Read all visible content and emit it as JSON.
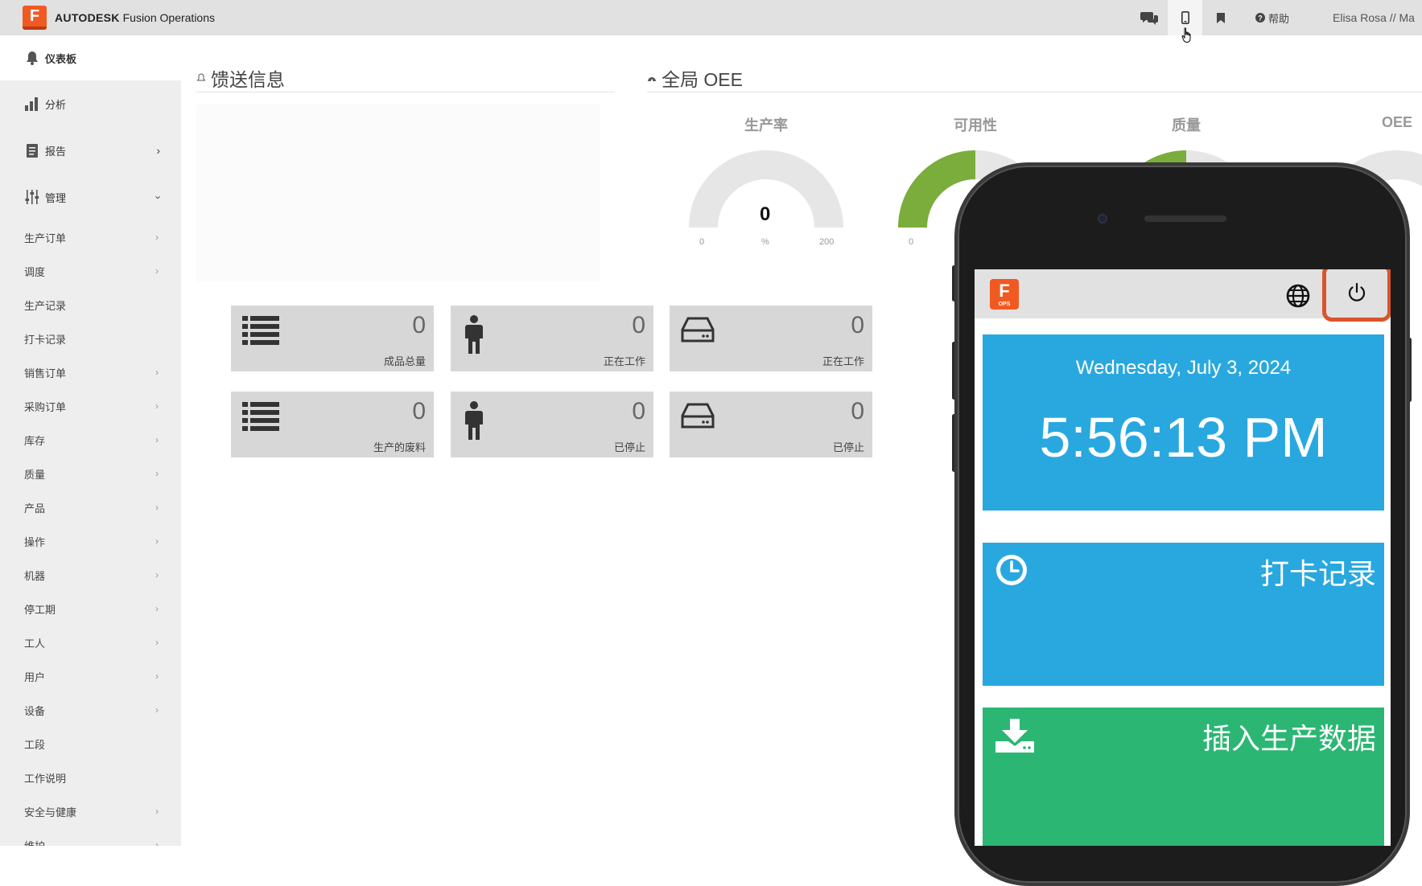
{
  "topbar": {
    "brand_bold": "AUTODESK",
    "brand_rest": " Fusion Operations",
    "help_label": "帮助",
    "user": "Elisa Rosa // Ma"
  },
  "sidebar": {
    "dashboard": "仪表板",
    "analysis": "分析",
    "reports": "报告",
    "manage": "管理",
    "items": [
      {
        "label": "生产订单",
        "chev": true
      },
      {
        "label": "调度",
        "chev": true
      },
      {
        "label": "生产记录",
        "chev": false
      },
      {
        "label": "打卡记录",
        "chev": false
      },
      {
        "label": "销售订单",
        "chev": true
      },
      {
        "label": "采购订单",
        "chev": true
      },
      {
        "label": "库存",
        "chev": true
      },
      {
        "label": "质量",
        "chev": true
      },
      {
        "label": "产品",
        "chev": true
      },
      {
        "label": "操作",
        "chev": true
      },
      {
        "label": "机器",
        "chev": true
      },
      {
        "label": "停工期",
        "chev": true
      },
      {
        "label": "工人",
        "chev": true
      },
      {
        "label": "用户",
        "chev": true
      },
      {
        "label": "设备",
        "chev": true
      },
      {
        "label": "工段",
        "chev": false
      },
      {
        "label": "工作说明",
        "chev": false
      },
      {
        "label": "安全与健康",
        "chev": true
      },
      {
        "label": "维护",
        "chev": true
      }
    ]
  },
  "feed": {
    "title": "馈送信息"
  },
  "oee": {
    "title": "全局 OEE",
    "gauges": [
      {
        "label": "生产率",
        "value": "0",
        "min": "0",
        "unit": "%",
        "max": "200",
        "fill": 0
      },
      {
        "label": "可用性",
        "min": "0",
        "fill": 1
      },
      {
        "label": "质量",
        "fill": 1
      },
      {
        "label": "OEE",
        "fill": 0
      }
    ]
  },
  "tiles": [
    {
      "icon": "list-icon",
      "value": "0",
      "label": "成品总量"
    },
    {
      "icon": "person-icon",
      "value": "0",
      "label": "正在工作"
    },
    {
      "icon": "drive-icon",
      "value": "0",
      "label": "正在工作"
    },
    {
      "icon": "list-icon",
      "value": "0",
      "label": "生产的废料"
    },
    {
      "icon": "person-icon",
      "value": "0",
      "label": "已停止"
    },
    {
      "icon": "drive-icon",
      "value": "0",
      "label": "已停止"
    }
  ],
  "mobile": {
    "logo_letter": "F",
    "logo_sub": "OPS",
    "date": "Wednesday, July 3, 2024",
    "time": "5:56:13 PM",
    "card1": "打卡记录",
    "card2": "插入生产数据"
  },
  "colors": {
    "accent_orange": "#f05a22",
    "gauge_green": "#7aad3b",
    "mobile_blue": "#29a8e0",
    "mobile_green": "#2bb673",
    "highlight": "#d9542b"
  }
}
